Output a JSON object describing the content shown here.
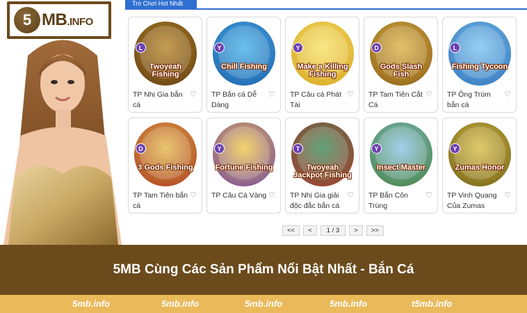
{
  "brand": {
    "logo_mark": "5",
    "logo_text": "MB",
    "logo_suffix": ".INFO"
  },
  "tabs": [
    {
      "label": "Trò Chơi Hot Nhất",
      "active": true
    }
  ],
  "games": [
    {
      "title_art": "Twoyeah Fishing",
      "badge": "L",
      "label": "TP Nhị Gia bắn cá",
      "colors": [
        "#b8862a",
        "#5c3a10"
      ]
    },
    {
      "title_art": "Chill Fishing",
      "badge": "Y",
      "label": "TP Bắn cá Dễ Dàng",
      "colors": [
        "#4ab3e8",
        "#1a5aa8"
      ]
    },
    {
      "title_art": "Make a Killing Fishing",
      "badge": "Y",
      "label": "TP Câu cá Phát Tài",
      "colors": [
        "#f7e36a",
        "#d6a21e"
      ]
    },
    {
      "title_art": "Gods Slash Fish",
      "badge": "D",
      "label": "TP Tam Tiên Cắt Cá",
      "colors": [
        "#d9b44a",
        "#8a5a12"
      ]
    },
    {
      "title_art": "Fishing Tycoon",
      "badge": "L",
      "label": "TP Ông Trùm bắn cá",
      "colors": [
        "#7fc4ef",
        "#2b6fb8"
      ]
    },
    {
      "title_art": "3 Gods Fishing",
      "badge": "D",
      "label": "TP Tam Tiên bắn cá",
      "colors": [
        "#e3b94e",
        "#a8321c"
      ]
    },
    {
      "title_art": "Fortune Fishing",
      "badge": "Y",
      "label": "TP Câu Cá Vàng",
      "colors": [
        "#f1c94a",
        "#6a3fa8"
      ]
    },
    {
      "title_art": "Twoyeah Jackpot Fishing",
      "badge": "T",
      "label": "TP Nhị Gia giải độc đắc bắn cá",
      "colors": [
        "#3e8d5a",
        "#b8322a"
      ]
    },
    {
      "title_art": "Insect Master",
      "badge": "Y",
      "label": "TP Bắn Côn Trùng",
      "colors": [
        "#8fc6e8",
        "#3c7a2a"
      ]
    },
    {
      "title_art": "Zumas Honor",
      "badge": "Y",
      "label": "TP Vinh Quang Của Zumas",
      "colors": [
        "#d9c04a",
        "#6b5a12"
      ]
    }
  ],
  "pager": {
    "first": "<<",
    "prev": "<",
    "current": "1 / 3",
    "next": ">",
    "last": ">>"
  },
  "banner": {
    "text": "5MB Cùng Các Sản Phẩm Nổi Bật Nhất - Bắn Cá"
  },
  "footer": {
    "links": [
      "5mb.info",
      "5mb.info",
      "5mb.info",
      "5mb.info",
      "t5mb.info"
    ]
  },
  "icons": {
    "favorite": "heart-icon"
  },
  "colors": {
    "brand": "#6b4a1c",
    "footer": "#eab95a",
    "tab": "#2f6fd1"
  }
}
